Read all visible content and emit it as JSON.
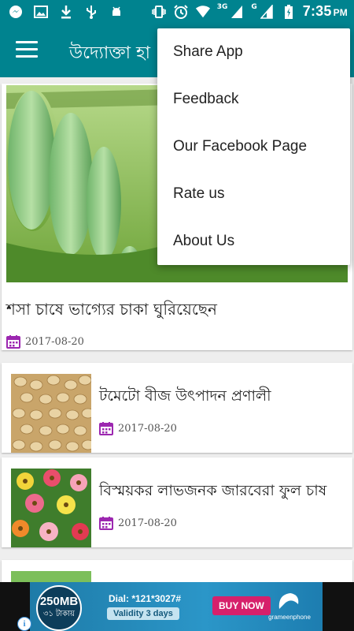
{
  "status_bar": {
    "time": "7:35",
    "ampm": "PM",
    "network_3g": "3G",
    "network_g": "G"
  },
  "app_bar": {
    "title": "উদ্যোক্তা হা"
  },
  "overflow_menu": {
    "items": [
      {
        "label": "Share App"
      },
      {
        "label": "Feedback"
      },
      {
        "label": "Our Facebook Page"
      },
      {
        "label": "Rate us"
      },
      {
        "label": "About Us"
      }
    ]
  },
  "articles": [
    {
      "title": "শসা চাষে ভাগ্যের চাকা ঘুরিয়েছেন",
      "date": "2017-08-20"
    },
    {
      "title": "টমেটো বীজ উৎপাদন প্রণালী",
      "date": "2017-08-20"
    },
    {
      "title": "বিস্ময়কর লাভজনক জারবেরা ফুল চাষ",
      "date": "2017-08-20"
    }
  ],
  "ad": {
    "bubble_big": "250MB",
    "bubble_small": "৩১ টাকায়",
    "dial": "Dial: *121*3027#",
    "validity": "Validity 3 days",
    "buy_label": "BUY NOW",
    "brand": "grameenphone"
  },
  "colors": {
    "primary": "#00838f",
    "calendar_icon": "#9c27b0",
    "ad_buy": "#d6206b"
  }
}
